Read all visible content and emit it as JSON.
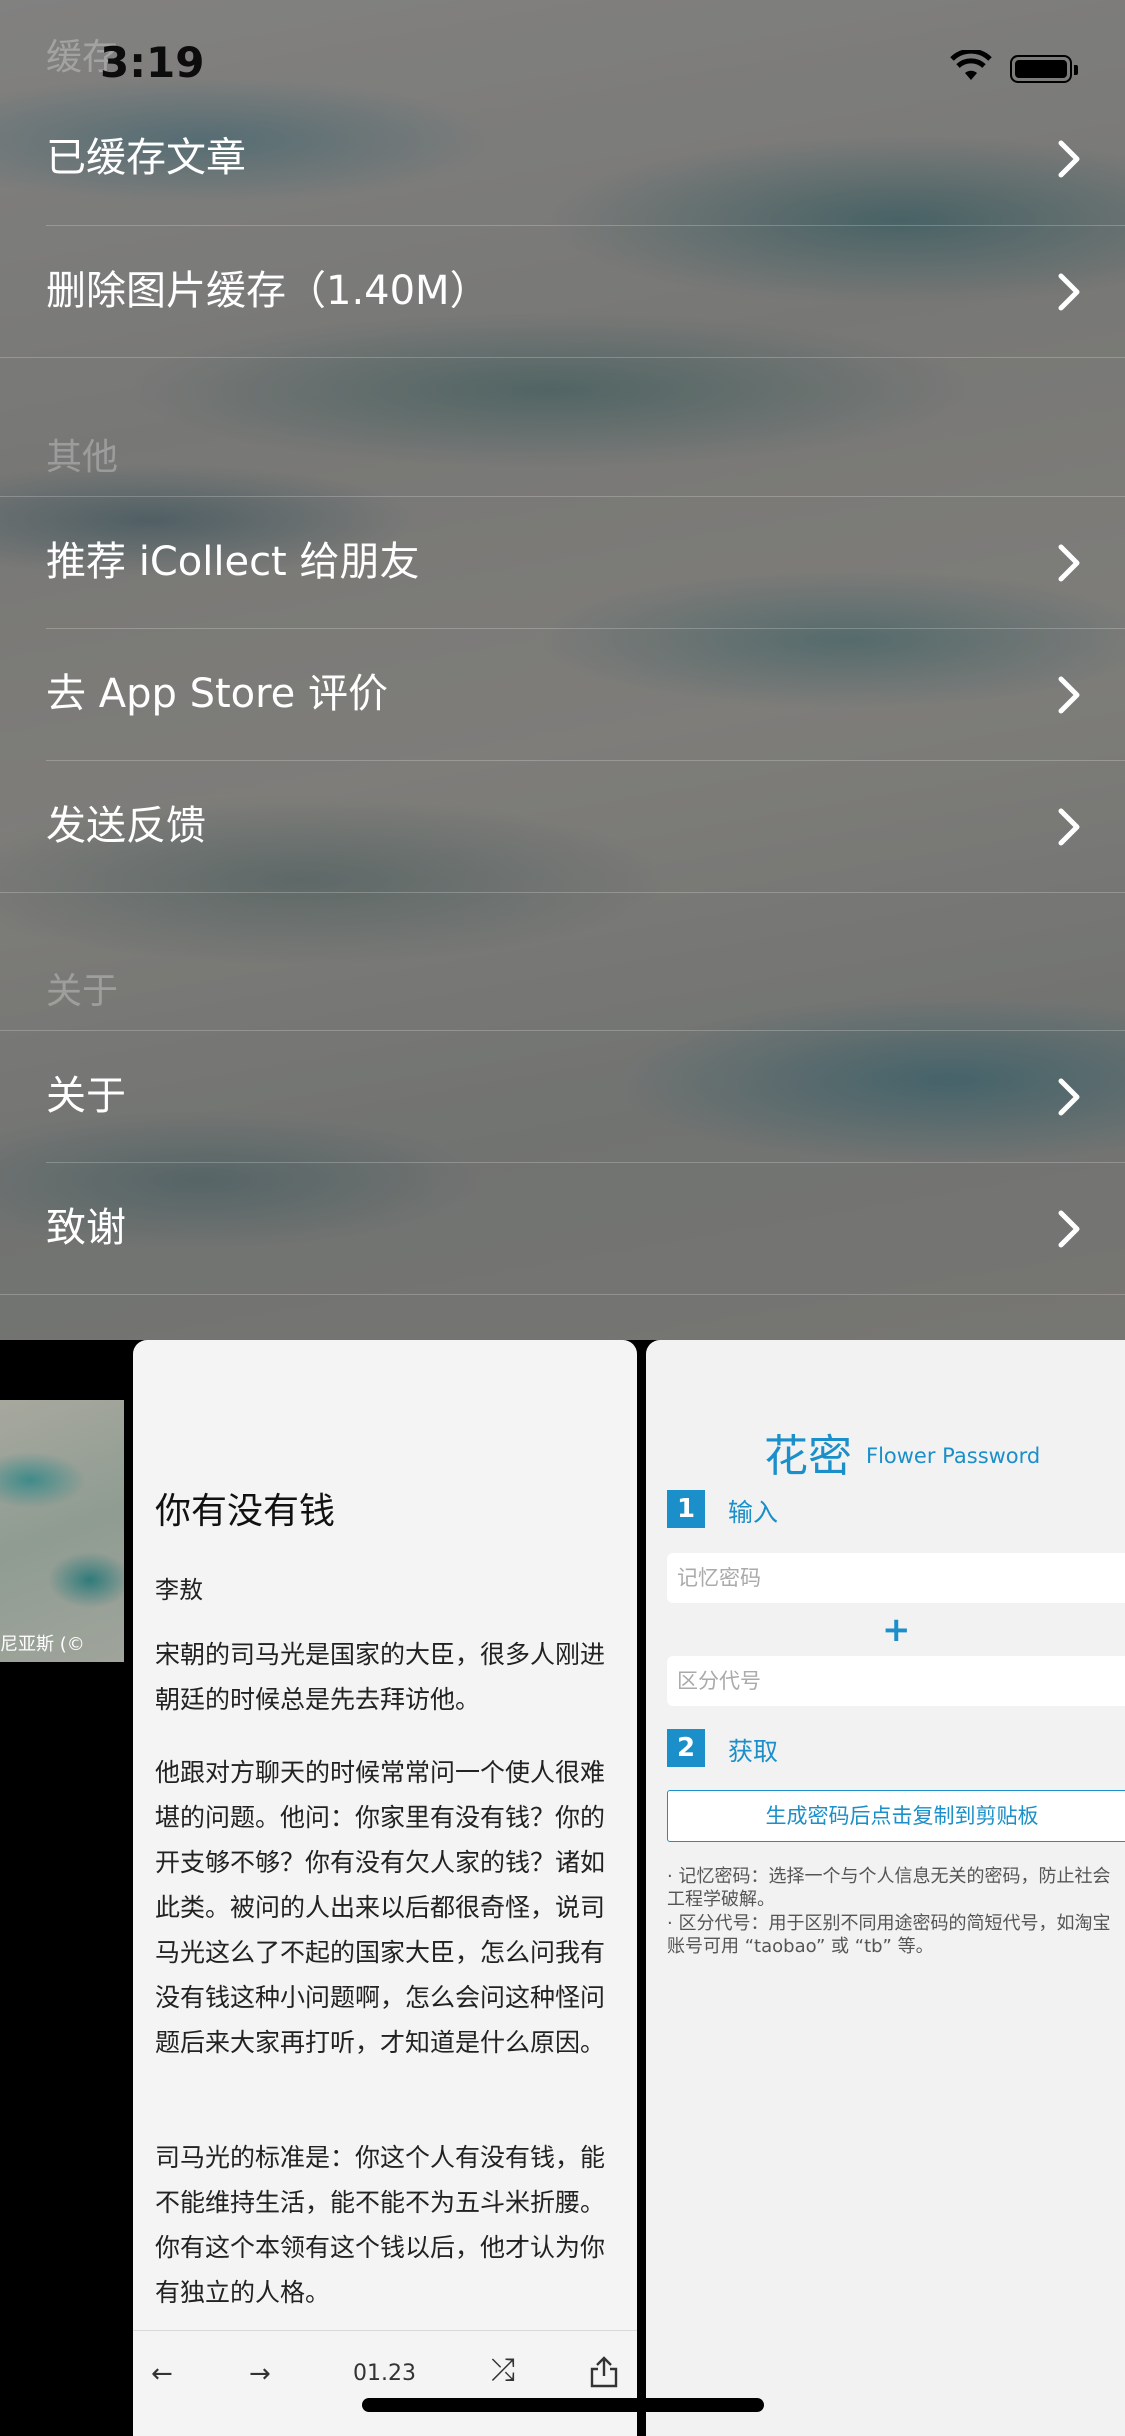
{
  "status_bar": {
    "time": "3:19"
  },
  "settings": {
    "section_cache": "缓存",
    "cached_articles": "已缓存文章",
    "clear_image_cache": "删除图片缓存（1.40M）",
    "section_other": "其他",
    "recommend": "推荐 iCollect 给朋友",
    "rate_app_store": "去 App Store 评价",
    "feedback": "发送反馈",
    "section_about": "关于",
    "about": "关于",
    "thanks": "致谢"
  },
  "card_photo": {
    "caption": "尼亚斯 (©"
  },
  "card_article": {
    "title": "你有没有钱",
    "author": "李敖",
    "paragraphs": [
      "宋朝的司马光是国家的大臣，很多人刚进朝廷的时候总是先去拜访他。",
      "他跟对方聊天的时候常常问一个使人很难堪的问题。他问：你家里有没有钱？你的开支够不够？你有没有欠人家的钱？诸如此类。被问的人出来以后都很奇怪，说司马光这么了不起的国家大臣，怎么问我有没有钱这种小问题啊，怎么会问这种怪问题后来大家再打听，才知道是什么原因。",
      "司马光的标准是：你这个人有没有钱，能不能维持生活，能不能不为五斗米折腰。你有这个本领有这个钱以后，他才认为你有独立的人格。"
    ],
    "toolbar": {
      "back": "←",
      "forward": "→",
      "date": "01.23",
      "shuffle": "⤮",
      "share": "share"
    }
  },
  "card_flower": {
    "logo_cn": "花密",
    "logo_en": "Flower Password",
    "step1_num": "1",
    "step1_label": "输入",
    "memory_placeholder": "记忆密码",
    "plus": "+",
    "code_placeholder": "区分代号",
    "step2_num": "2",
    "step2_label": "获取",
    "generate_button": "生成密码后点击复制到剪贴板",
    "note1": "· 记忆密码：选择一个与个人信息无关的密码，防止社会工程学破解。",
    "note2": "· 区分代号：用于区别不同用途密码的简短代号，如淘宝账号可用 “taobao” 或 “tb” 等。"
  }
}
